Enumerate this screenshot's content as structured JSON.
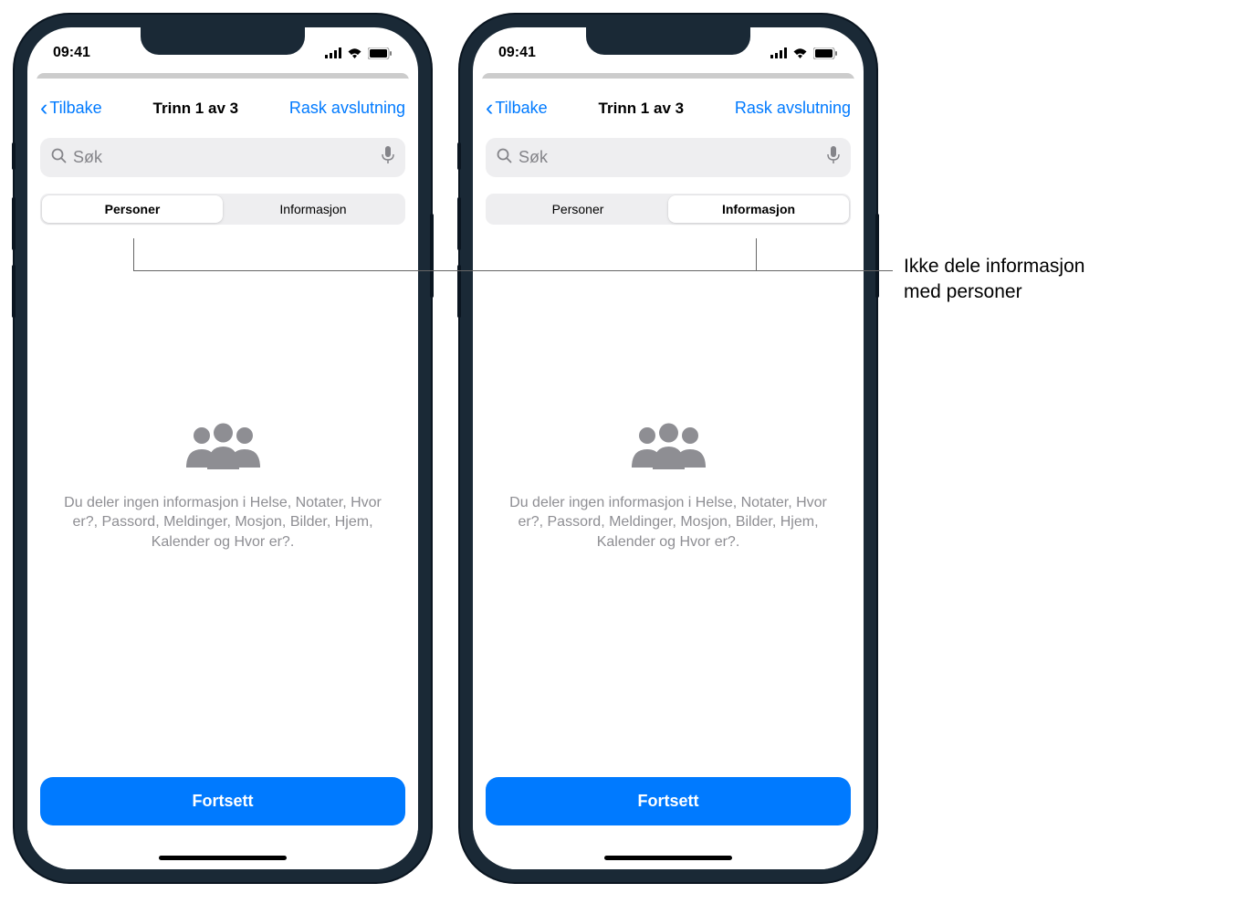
{
  "statusBar": {
    "time": "09:41"
  },
  "navBar": {
    "backLabel": "Tilbake",
    "title": "Trinn 1 av 3",
    "actionLabel": "Rask avslutning"
  },
  "search": {
    "placeholder": "Søk"
  },
  "segments": {
    "personer": "Personer",
    "informasjon": "Informasjon"
  },
  "emptyState": {
    "text": "Du deler ingen informasjon i Helse, Notater, Hvor er?, Passord, Meldinger, Mosjon, Bilder, Hjem, Kalender og Hvor er?."
  },
  "continueButton": {
    "label": "Fortsett"
  },
  "callout": {
    "line1": "Ikke dele informasjon",
    "line2": "med personer"
  }
}
